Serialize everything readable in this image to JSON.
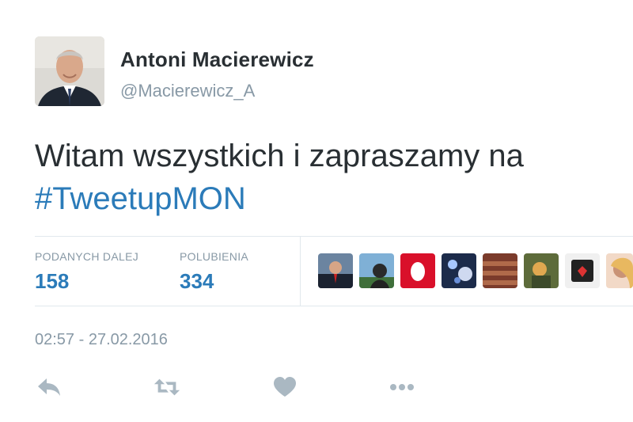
{
  "author": {
    "name": "Antoni Macierewicz",
    "handle": "@Macierewicz_A"
  },
  "tweet": {
    "text_line1": "Witam wszystkich i zapraszamy na",
    "hashtag": "#TweetupMON"
  },
  "stats": {
    "retweets_label": "PODANYCH DALEJ",
    "retweets_value": "158",
    "likes_label": "POLUBIENIA",
    "likes_value": "334"
  },
  "timestamp": "02:57 - 27.02.2016",
  "colors": {
    "link": "#2b7bb9",
    "muted": "#8899a6",
    "text": "#292f33",
    "icon": "#aab8c2"
  },
  "actions": {
    "reply_icon": "reply-icon",
    "retweet_icon": "retweet-icon",
    "like_icon": "heart-icon",
    "more_icon": "more-icon"
  }
}
